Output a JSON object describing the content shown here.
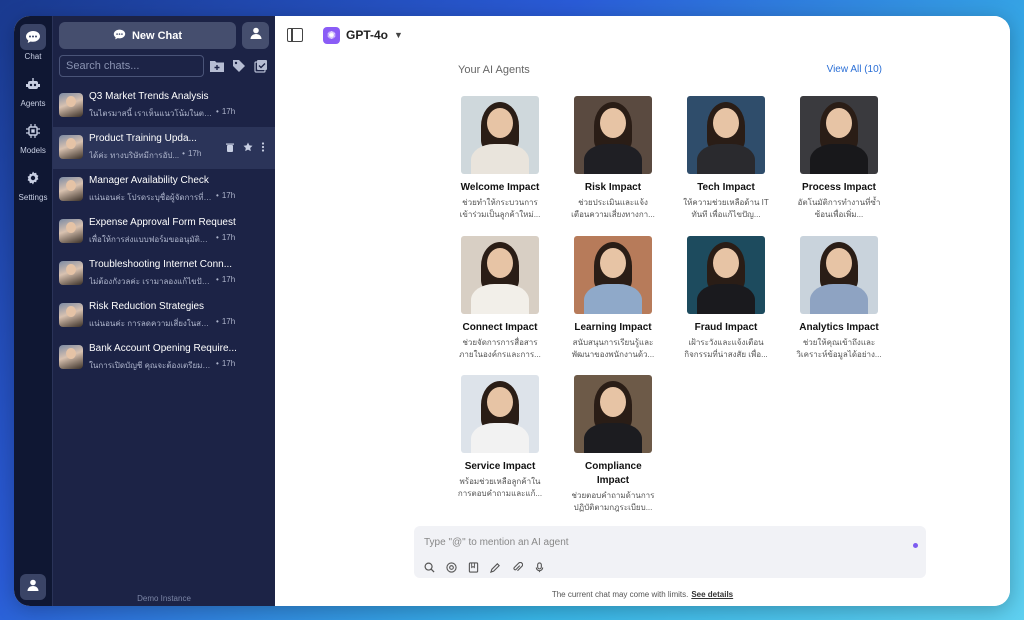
{
  "rail": {
    "items": [
      {
        "label": "Chat",
        "icon": "chat-bubble-icon",
        "active": true
      },
      {
        "label": "Agents",
        "icon": "robot-icon"
      },
      {
        "label": "Models",
        "icon": "chip-icon"
      },
      {
        "label": "Settings",
        "icon": "gear-icon"
      }
    ]
  },
  "sidebar": {
    "new_chat_label": "New Chat",
    "search_placeholder": "Search chats...",
    "footer": "Demo Instance",
    "chats": [
      {
        "title": "Q3 Market Trends Analysis",
        "preview": "ในไตรมาสนี้ เราเห็นแนวโน้มในตลา...",
        "time": "17h"
      },
      {
        "title": "Product Training Upda...",
        "preview": "ได้ค่ะ ทางบริษัทมีการอัป...",
        "time": "17h"
      },
      {
        "title": "Manager Availability Check",
        "preview": "แน่นอนค่ะ โปรดระบุชื่อผู้จัดการที่คุ...",
        "time": "17h"
      },
      {
        "title": "Expense Approval Form Request",
        "preview": "เพื่อให้การส่งแบบฟอร์มขออนุมัติค่า...",
        "time": "17h"
      },
      {
        "title": "Troubleshooting Internet Conn...",
        "preview": "ไม่ต้องกังวลค่ะ เรามาลองแก้ไขปัญ...",
        "time": "17h"
      },
      {
        "title": "Risk Reduction Strategies",
        "preview": "แน่นอนค่ะ การลดความเสี่ยงในสภา...",
        "time": "17h"
      },
      {
        "title": "Bank Account Opening Require...",
        "preview": "ในการเปิดบัญชี คุณจะต้องเตรียมเอ...",
        "time": "17h"
      }
    ]
  },
  "header": {
    "model_name": "GPT-4o"
  },
  "agents": {
    "section_title": "Your AI Agents",
    "view_all": "View All (10)",
    "items": [
      {
        "name": "Welcome Impact",
        "desc": "ช่วยทำให้กระบวนการเข้าร่วมเป็นลูกค้าใหม่...",
        "bg": "#cfd8dc",
        "outfit": "#e9e4dc"
      },
      {
        "name": "Risk Impact",
        "desc": "ช่วยประเมินและแจ้งเตือนความเสี่ยงทางกา...",
        "bg": "#5a4a40",
        "outfit": "#1f1f24"
      },
      {
        "name": "Tech Impact",
        "desc": "ให้ความช่วยเหลือด้าน IT ทันที เพื่อแก้ไขปัญ...",
        "bg": "#2f4d6b",
        "outfit": "#2a2a2e"
      },
      {
        "name": "Process Impact",
        "desc": "อัตโนมัติการทำงานที่ซ้ำซ้อนเพื่อเพิ่ม...",
        "bg": "#3a3a3e",
        "outfit": "#18181b"
      },
      {
        "name": "Connect Impact",
        "desc": "ช่วยจัดการการสื่อสารภายในองค์กรและการ...",
        "bg": "#d8cfc4",
        "outfit": "#f2efe9"
      },
      {
        "name": "Learning Impact",
        "desc": "สนับสนุนการเรียนรู้และพัฒนาของพนักงานด้ว...",
        "bg": "#b77b5a",
        "outfit": "#8fa9c9"
      },
      {
        "name": "Fraud Impact",
        "desc": "เฝ้าระวังและแจ้งเตือนกิจกรรมที่น่าสงสัย เพื่อ...",
        "bg": "#1d4b5e",
        "outfit": "#1a1a1e"
      },
      {
        "name": "Analytics Impact",
        "desc": "ช่วยให้คุณเข้าถึงและวิเคราะห์ข้อมูลได้อย่าง...",
        "bg": "#c9d3dc",
        "outfit": "#8ea3c2"
      },
      {
        "name": "Service Impact",
        "desc": "พร้อมช่วยเหลือลูกค้าในการตอบคำถามและแก้...",
        "bg": "#dde3ea",
        "outfit": "#f2f2f2"
      },
      {
        "name": "Compliance Impact",
        "desc": "ช่วยตอบคำถามด้านการปฏิบัติตามกฎระเบียบ...",
        "bg": "#6d5a48",
        "outfit": "#1c1c20"
      }
    ]
  },
  "composer": {
    "placeholder": "Type \"@\" to mention an AI agent",
    "tools": [
      "search-icon",
      "at-icon",
      "bookmark-icon",
      "pen-icon",
      "paperclip-icon",
      "microphone-icon"
    ]
  },
  "footer": {
    "note": "The current chat may come with limits.",
    "link": "See details"
  }
}
